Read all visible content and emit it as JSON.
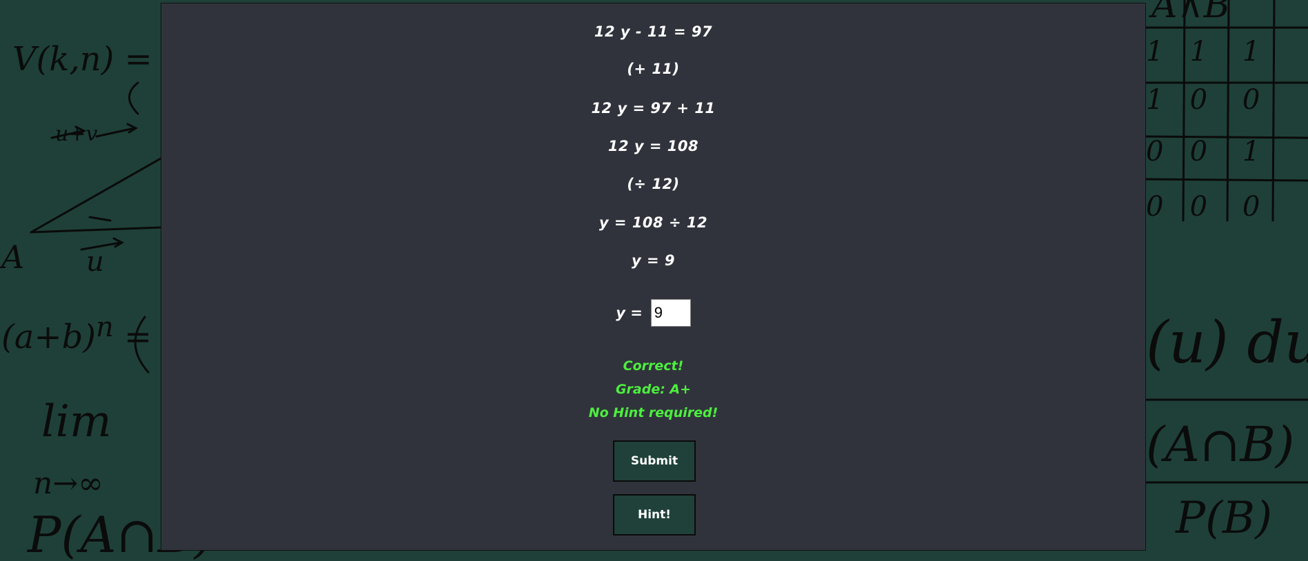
{
  "background": {
    "color": "#1e4038",
    "panel_color": "#31333c"
  },
  "steps": [
    "12 y - 11 = 97",
    "(+ 11)",
    "12 y = 97 + 11",
    "12 y = 108",
    "(÷ 12)",
    "y = 108 ÷ 12",
    "y = 9"
  ],
  "answer": {
    "label": "y =",
    "value": "9"
  },
  "feedback": {
    "color": "#4cef3e",
    "correct": "Correct!",
    "grade": "Grade: A+",
    "hint_status": "No Hint required!"
  },
  "buttons": {
    "submit": "Submit",
    "hint": "Hint!"
  }
}
